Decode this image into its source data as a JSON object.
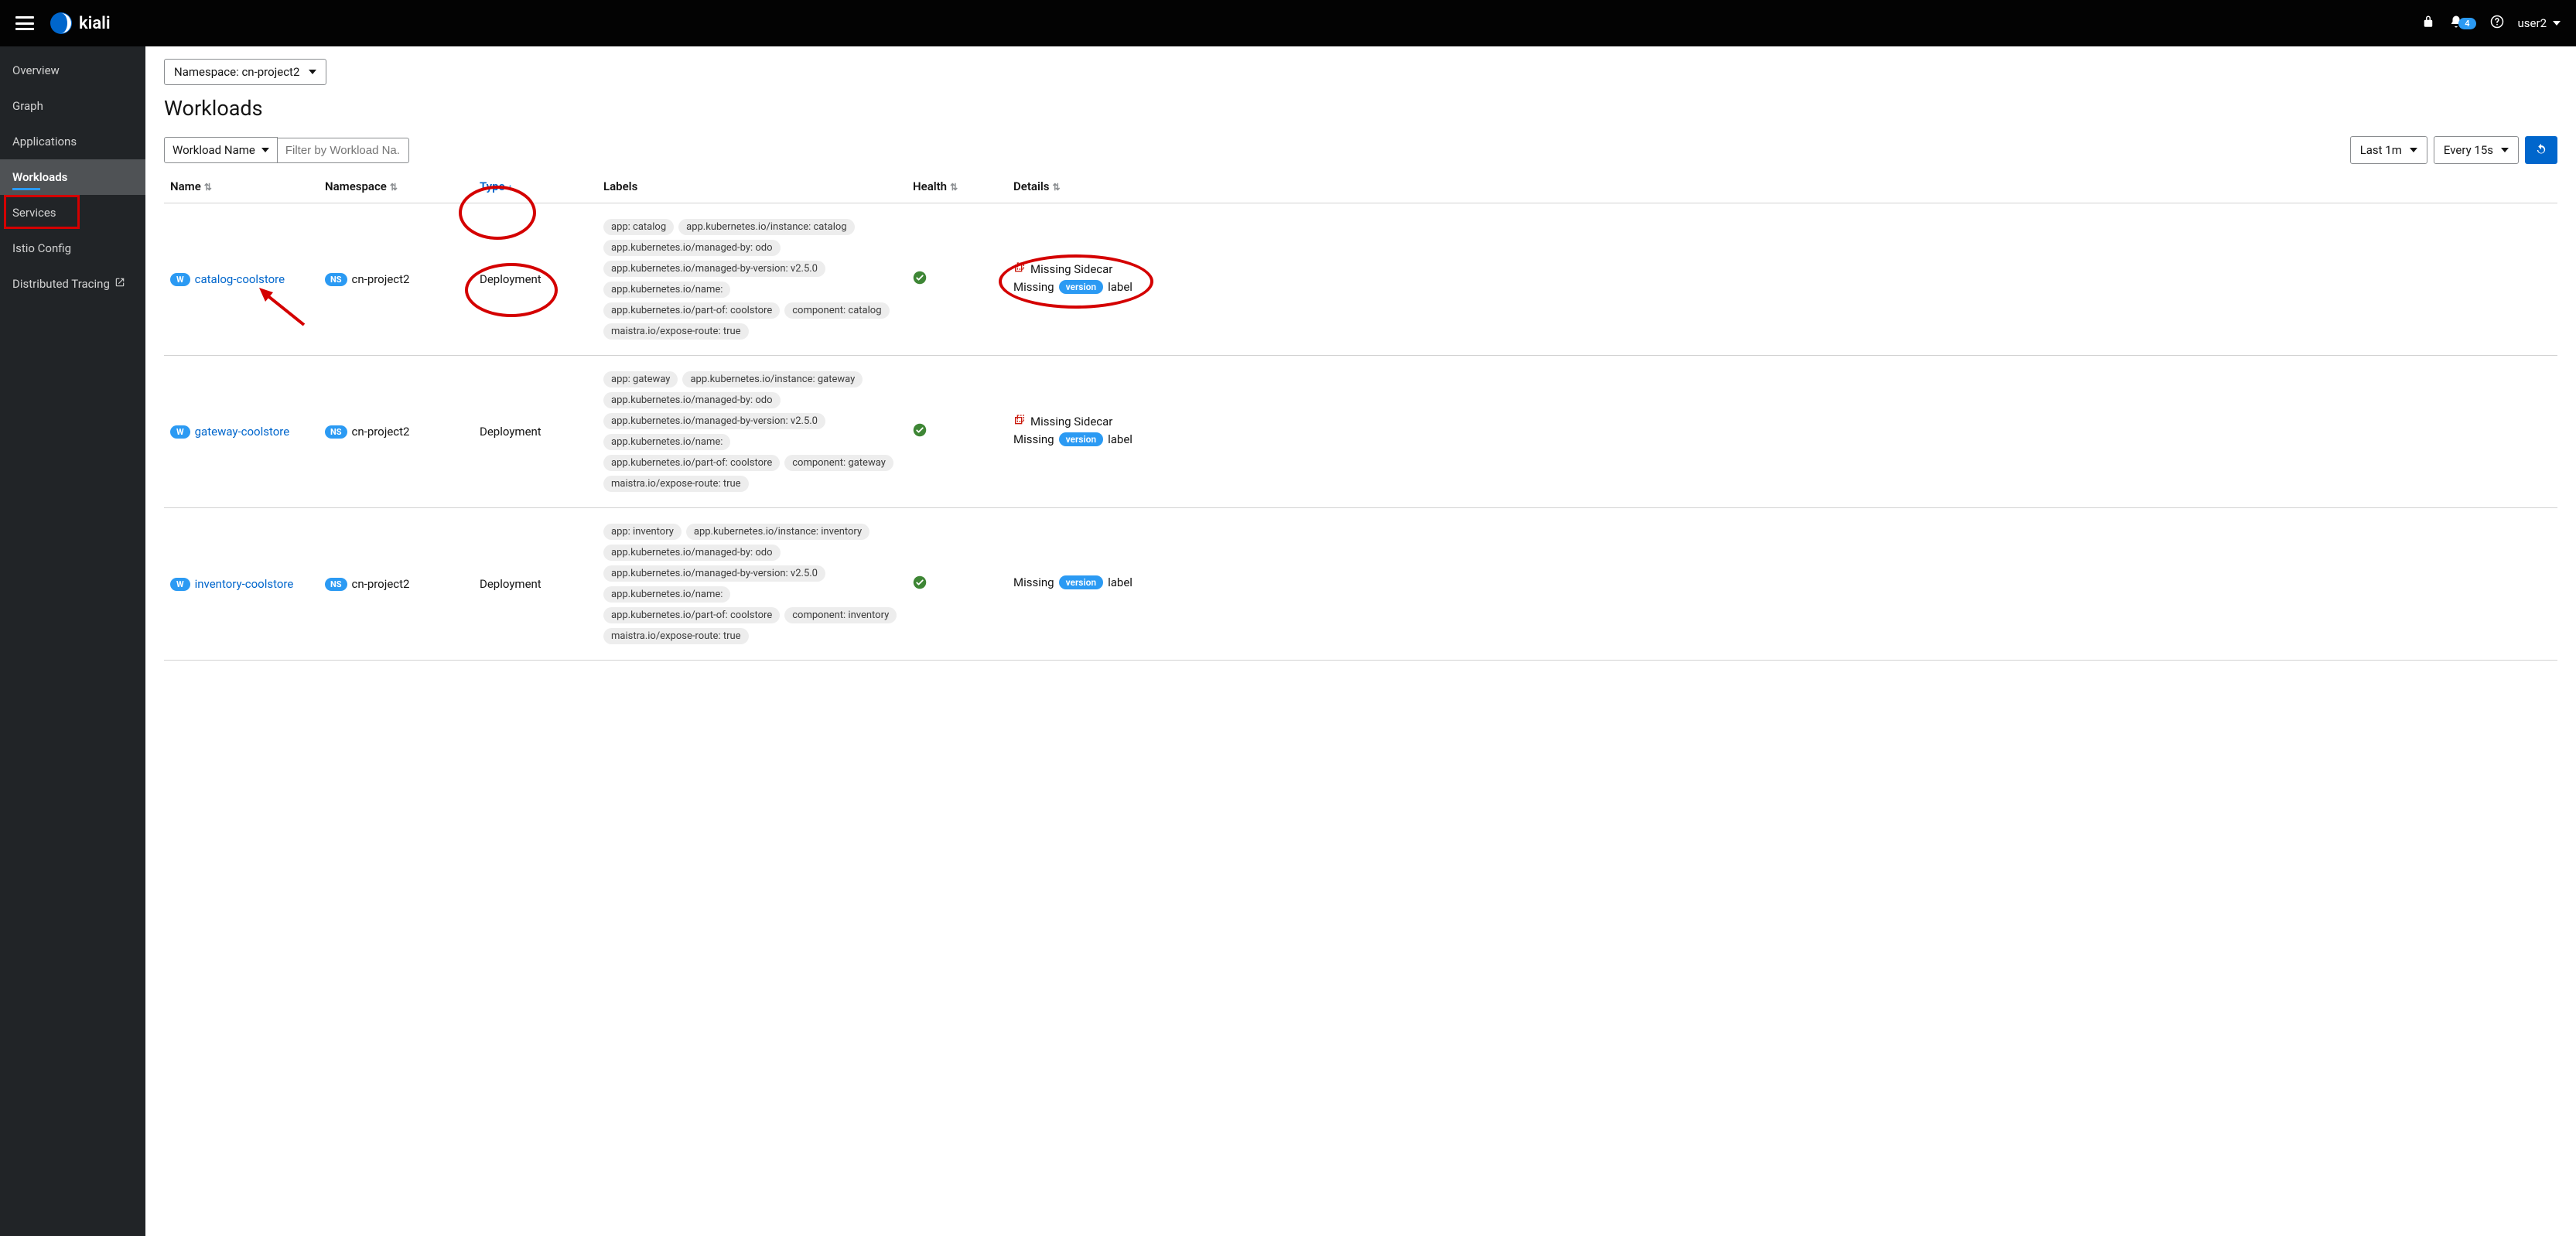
{
  "topbar": {
    "brand": "kiali",
    "notification_count": "4",
    "username": "user2"
  },
  "sidebar": {
    "items": [
      {
        "label": "Overview"
      },
      {
        "label": "Graph"
      },
      {
        "label": "Applications"
      },
      {
        "label": "Workloads"
      },
      {
        "label": "Services"
      },
      {
        "label": "Istio Config"
      },
      {
        "label": "Distributed Tracing"
      }
    ]
  },
  "namespace_selector": "Namespace: cn-project2",
  "page_title": "Workloads",
  "toolbar": {
    "filter_type": "Workload Name",
    "filter_placeholder": "Filter by Workload Na...",
    "time_range": "Last 1m",
    "refresh_interval": "Every 15s"
  },
  "columns": {
    "name": "Name",
    "namespace": "Namespace",
    "type": "Type",
    "labels": "Labels",
    "health": "Health",
    "details": "Details"
  },
  "badges": {
    "workload": "W",
    "namespace": "NS"
  },
  "details_text": {
    "missing_sidecar": "Missing Sidecar",
    "missing_prefix": "Missing",
    "version_chip": "version",
    "label_suffix": "label"
  },
  "rows": [
    {
      "name": "catalog-coolstore",
      "namespace": "cn-project2",
      "type": "Deployment",
      "labels": [
        "app: catalog",
        "app.kubernetes.io/instance: catalog",
        "app.kubernetes.io/managed-by: odo",
        "app.kubernetes.io/managed-by-version: v2.5.0",
        "app.kubernetes.io/name:",
        "app.kubernetes.io/part-of: coolstore",
        "component: catalog",
        "maistra.io/expose-route: true"
      ],
      "missing_sidecar": true,
      "missing_version": true
    },
    {
      "name": "gateway-coolstore",
      "namespace": "cn-project2",
      "type": "Deployment",
      "labels": [
        "app: gateway",
        "app.kubernetes.io/instance: gateway",
        "app.kubernetes.io/managed-by: odo",
        "app.kubernetes.io/managed-by-version: v2.5.0",
        "app.kubernetes.io/name:",
        "app.kubernetes.io/part-of: coolstore",
        "component: gateway",
        "maistra.io/expose-route: true"
      ],
      "missing_sidecar": true,
      "missing_version": true
    },
    {
      "name": "inventory-coolstore",
      "namespace": "cn-project2",
      "type": "Deployment",
      "labels": [
        "app: inventory",
        "app.kubernetes.io/instance: inventory",
        "app.kubernetes.io/managed-by: odo",
        "app.kubernetes.io/managed-by-version: v2.5.0",
        "app.kubernetes.io/name:",
        "app.kubernetes.io/part-of: coolstore",
        "component: inventory",
        "maistra.io/expose-route: true"
      ],
      "missing_sidecar": false,
      "missing_version": true
    }
  ]
}
